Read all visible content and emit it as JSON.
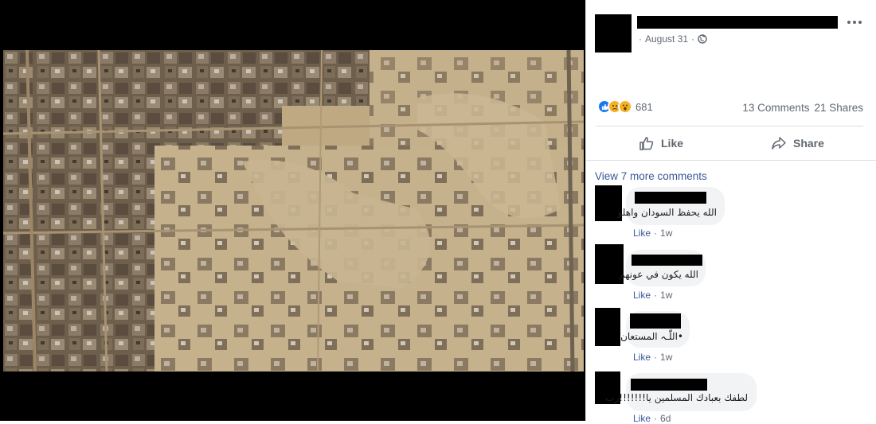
{
  "post": {
    "date": "August 31",
    "separator": "·",
    "privacy_icon": "globe-icon",
    "reactions": {
      "icons": [
        "like-reaction-icon",
        "sad-reaction-icon",
        "wow-reaction-icon"
      ],
      "count": "681"
    },
    "comments_count": "13 Comments",
    "shares_count": "21 Shares"
  },
  "actions": {
    "like_label": "Like",
    "share_label": "Share"
  },
  "comments_section": {
    "view_more_label": "View 7 more comments",
    "comments": [
      {
        "text": "الله يحفظ السودان واهلو",
        "like_label": "Like",
        "age": "1w"
      },
      {
        "text": "الله يكون في عونهم",
        "like_label": "Like",
        "age": "1w"
      },
      {
        "text": "•اللّٰـہ المستعان",
        "like_label": "Like",
        "age": "1w"
      },
      {
        "text": "لطفك بعبادك المسلمين يا!!!!!!!رب",
        "like_label": "Like",
        "age": "6d"
      }
    ]
  },
  "colors": {
    "link": "#385898",
    "meta": "#606770",
    "bubble": "#f2f3f5",
    "like_blue": "#1877f2",
    "reaction_yellow": "#f7b125"
  }
}
